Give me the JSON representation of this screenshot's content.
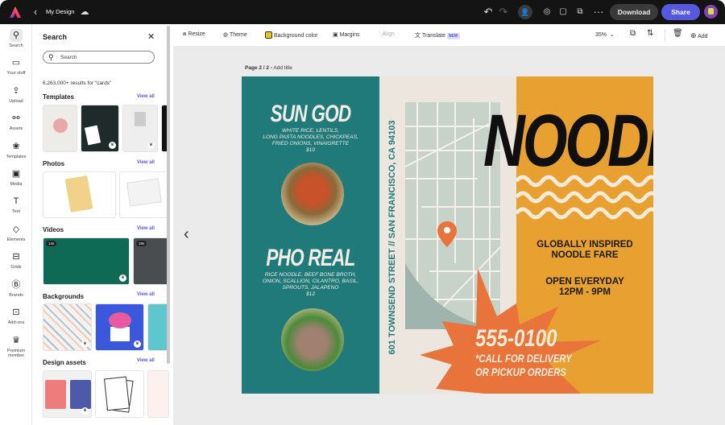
{
  "topbar": {
    "doc_title": "My Design",
    "download_label": "Download",
    "share_label": "Share",
    "icons": [
      "adobe-express-logo",
      "back-chevron",
      "cloud-icon",
      "undo-icon",
      "redo-icon",
      "invite-icon",
      "lightbulb-icon",
      "comment-icon",
      "share-link-icon",
      "more-icon",
      "avatar"
    ]
  },
  "rail": {
    "items": [
      {
        "label": "Search",
        "icon": "search-icon"
      },
      {
        "label": "Your stuff",
        "icon": "folder-icon"
      },
      {
        "label": "Upload",
        "icon": "upload-icon"
      },
      {
        "label": "Assets",
        "icon": "assets-icon"
      },
      {
        "label": "Templates",
        "icon": "templates-icon"
      },
      {
        "label": "Media",
        "icon": "media-icon"
      },
      {
        "label": "Text",
        "icon": "text-icon"
      },
      {
        "label": "Elements",
        "icon": "elements-icon"
      },
      {
        "label": "Grids",
        "icon": "grids-icon"
      },
      {
        "label": "Brands",
        "icon": "brands-icon"
      },
      {
        "label": "Add-ons",
        "icon": "addons-icon"
      },
      {
        "label": "Premium member",
        "icon": "crown-icon"
      }
    ]
  },
  "panel": {
    "title": "Search",
    "search_placeholder": "Search",
    "results_text": "6,263,000+ results for \"cards\"",
    "view_all": "View all",
    "sections": [
      "Templates",
      "Photos",
      "Videos",
      "Backgrounds",
      "Design assets"
    ],
    "video_durations": [
      "14s",
      "19s"
    ]
  },
  "toolbar": {
    "resize": "Resize",
    "theme": "Theme",
    "background_color": "Background color",
    "margins": "Margins",
    "align": "Align",
    "translate": "Translate",
    "new_badge": "NEW",
    "zoom": "35%",
    "add": "Add",
    "bg_swatch": "#f2c31b"
  },
  "canvas": {
    "page_label": "Page 2 / 2 -",
    "add_title": "Add title"
  },
  "design": {
    "colors": {
      "teal": "#217a7a",
      "orange": "#e8a031",
      "starburst": "#e8743b",
      "map": "#ece6df"
    },
    "dish1": {
      "title": "SUN GOD",
      "desc1": "WHITE RICE, LENTILS,",
      "desc2": "LONG PASTA NOODLES, CHICKPEAS,",
      "desc3": "FRIED ONIONS, VINAIGRETTE",
      "price": "$10"
    },
    "dish2": {
      "title": "PHO REAL",
      "desc1": "RICE NOODLE, BEEF BONE BROTH,",
      "desc2": "ONION, SCALLION, CILANTRO, BASIL,",
      "desc3": "SPROUTS, JALAPENO",
      "price": "$12"
    },
    "address": "601 TOWNSEND STREET // SAN FRANCISCO, CA 94103",
    "headline": "NOODL",
    "tagline1": "GLOBALLY INSPIRED",
    "tagline2": "NOODLE FARE",
    "hours1": "OPEN EVERYDAY",
    "hours2": "12PM - 9PM",
    "phone": "555-0100",
    "cta1": "*CALL FOR DELIVERY",
    "cta2": "OR PICKUP ORDERS"
  }
}
